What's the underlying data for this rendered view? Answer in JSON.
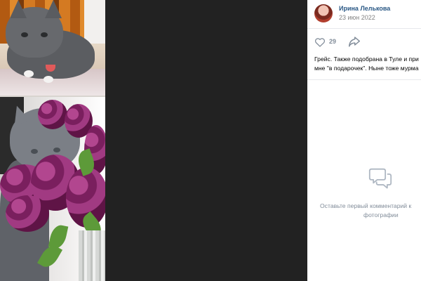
{
  "post": {
    "author": "Ирина Лелькова",
    "date": "23 июн 2022",
    "likes": "29",
    "text_line1": "Грейс. Также подобрана в Туле и при",
    "text_line2": "мне \"в подарочек\". Ныне тоже мурма"
  },
  "comments": {
    "empty_line1": "Оставьте первый комментарий к",
    "empty_line2": "фотографии"
  },
  "icons": {
    "like": "heart-icon",
    "share": "share-icon",
    "comments": "comment-icon"
  },
  "colors": {
    "author_link": "#2a5885",
    "muted": "#818c99",
    "viewer_bg": "#222222"
  }
}
